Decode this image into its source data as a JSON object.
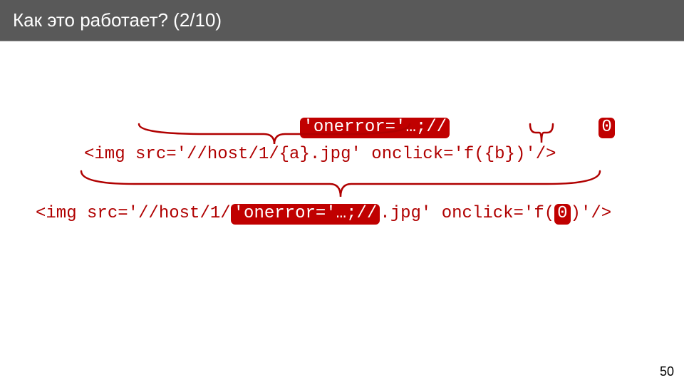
{
  "header": {
    "title": "Как это работает? (2/10)"
  },
  "top_boxes": {
    "a_value": "'onerror='…;//",
    "b_value": "0"
  },
  "template_line": {
    "prefix": "<img src='//host/1/",
    "a_token": "{a}",
    "mid": ".jpg' onclick='f(",
    "b_token": "{b}",
    "suffix": ")'/>"
  },
  "result_line": {
    "prefix": "<img src='//host/1/",
    "a_value": "'onerror='…;//",
    "mid": ".jpg' onclick='f(",
    "b_value": "0",
    "suffix": ")'/>"
  },
  "page_number": "50"
}
